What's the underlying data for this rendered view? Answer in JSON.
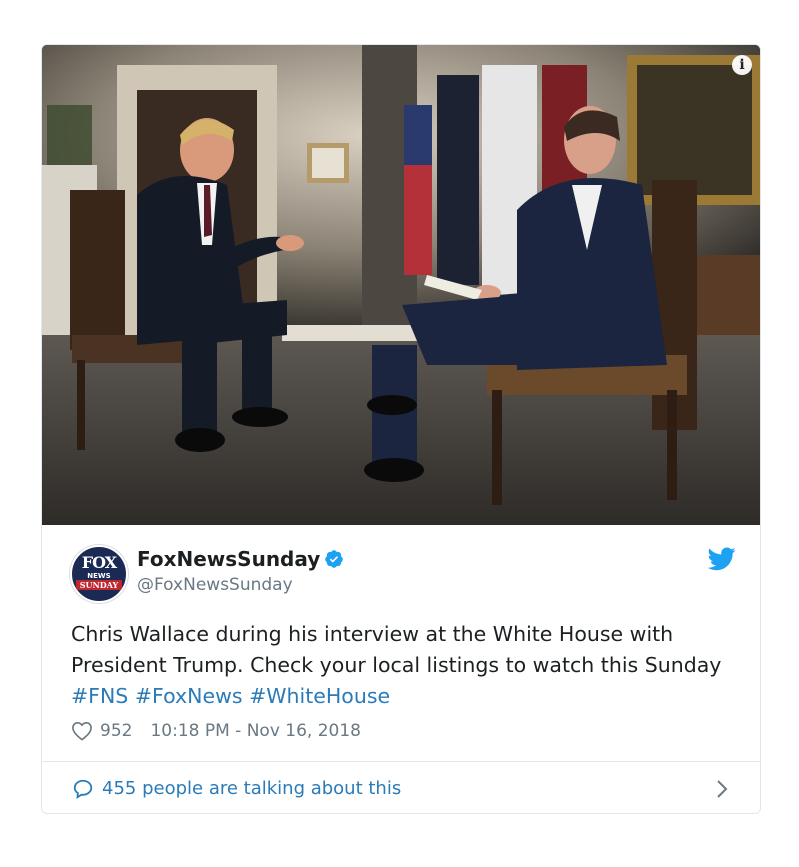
{
  "media": {
    "description_icon": "info-icon",
    "info_symbol": "i"
  },
  "tweet": {
    "avatar": {
      "line1": "FOX",
      "line2": "NEWS",
      "line3": "SUNDAY"
    },
    "display_name": "FoxNewsSunday",
    "handle": "@FoxNewsSunday",
    "verified_icon": "verified-badge-icon",
    "brand_icon": "twitter-bird-icon",
    "text_plain": "Chris Wallace during his interview at the White House with President Trump. Check your local listings to watch this Sunday ",
    "hashtags": [
      "#FNS",
      "#FoxNews",
      "#WhiteHouse"
    ],
    "like_count": "952",
    "timestamp": "10:18 PM - Nov 16, 2018"
  },
  "footer": {
    "talking_text": "455 people are talking about this",
    "bubble_icon": "speech-bubble-icon",
    "chevron_icon": "chevron-right-icon"
  },
  "colors": {
    "link": "#2b7bb9",
    "verified": "#1da1f2",
    "twitter_blue": "#1da1f2",
    "muted": "#697882",
    "border": "#e1e8ed"
  }
}
